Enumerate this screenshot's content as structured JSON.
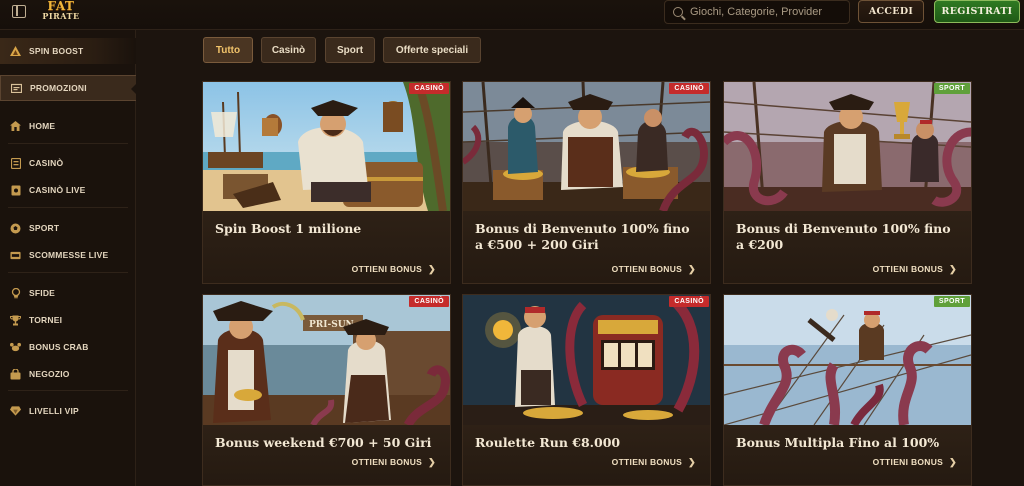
{
  "header": {
    "logo_line1": "FAT",
    "logo_line2": "PIRATE",
    "search_placeholder": "Giochi, Categorie, Provider",
    "login_label": "ACCEDI",
    "register_label": "REGISTRATI"
  },
  "sidebar": {
    "items": [
      {
        "label": "SPIN BOOST",
        "icon": "spin-boost-icon"
      },
      {
        "label": "PROMOZIONI",
        "icon": "promotions-icon"
      },
      {
        "label": "HOME",
        "icon": "home-icon"
      },
      {
        "label": "CASINÒ",
        "icon": "casino-icon"
      },
      {
        "label": "CASINÒ LIVE",
        "icon": "live-casino-icon"
      },
      {
        "label": "SPORT",
        "icon": "sport-icon"
      },
      {
        "label": "SCOMMESSE LIVE",
        "icon": "live-bets-icon"
      },
      {
        "label": "SFIDE",
        "icon": "challenges-icon"
      },
      {
        "label": "TORNEI",
        "icon": "trophy-icon"
      },
      {
        "label": "BONUS CRAB",
        "icon": "crab-icon"
      },
      {
        "label": "NEGOZIO",
        "icon": "shop-icon"
      },
      {
        "label": "LIVELLI VIP",
        "icon": "vip-diamond-icon"
      }
    ]
  },
  "filters": [
    "Tutto",
    "Casinò",
    "Sport",
    "Offerte speciali"
  ],
  "cards": [
    {
      "title": "Spin Boost 1 milione",
      "badge": "CASINÒ",
      "cta": "OTTIENI BONUS"
    },
    {
      "title": "Bonus di Benvenuto 100% fino a €500 + 200 Giri",
      "badge": "CASINÒ",
      "cta": "OTTIENI BONUS"
    },
    {
      "title": "Bonus di Benvenuto 100% fino a €200",
      "badge": "SPORT",
      "cta": "OTTIENI BONUS"
    },
    {
      "title": "Bonus weekend €700 + 50 Giri",
      "badge": "CASINÒ",
      "cta": "OTTIENI BONUS"
    },
    {
      "title": "Roulette Run €8.000",
      "badge": "CASINÒ",
      "cta": "OTTIENI BONUS"
    },
    {
      "title": "Bonus Multipla Fino al 100%",
      "badge": "SPORT",
      "cta": "OTTIENI BONUS"
    }
  ],
  "art_signs": {
    "card4_sign": "PRI-SUN"
  },
  "colors": {
    "background": "#1c140e",
    "accent_gold": "#f1c36a",
    "register_green": "#2f7a22",
    "casino_badge": "#c52b2b",
    "sport_badge": "#5fa03a"
  }
}
